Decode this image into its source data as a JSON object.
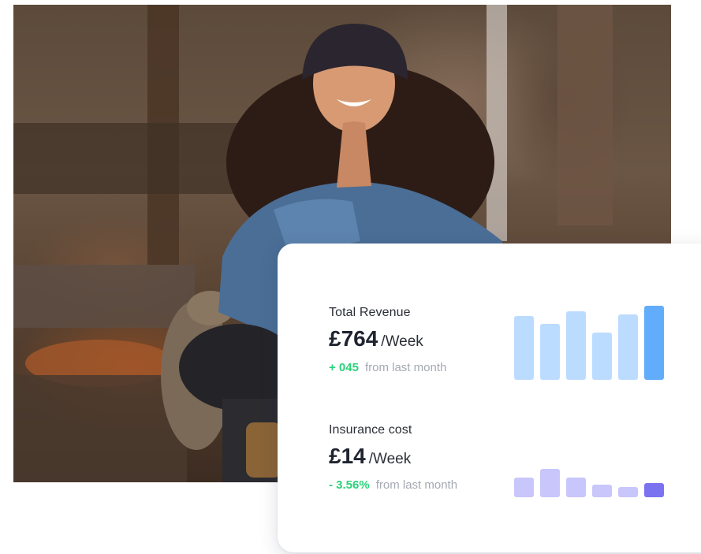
{
  "revenue": {
    "label": "Total Revenue",
    "value": "£764",
    "unit": "/Week",
    "change": "+ 045",
    "change_suffix": "from last month",
    "bar_levels": [
      0.86,
      0.75,
      0.93,
      0.64,
      0.88,
      1.0
    ],
    "bar_colors": [
      "#bcdcff",
      "#bcdcff",
      "#bcdcff",
      "#bcdcff",
      "#bcdcff",
      "#62adfb"
    ]
  },
  "insurance": {
    "label": "Insurance cost",
    "value": "£14",
    "unit": "/Week",
    "change": "- 3.56%",
    "change_suffix": "from last month",
    "bar_levels": [
      0.7,
      1.0,
      0.7,
      0.45,
      0.35,
      0.5
    ],
    "bar_colors": [
      "#c9c6fb",
      "#c9c6fb",
      "#c9c6fb",
      "#c9c6fb",
      "#c9c6fb",
      "#7b72ef"
    ]
  },
  "colors": {
    "accent_green": "#2bd27a"
  }
}
